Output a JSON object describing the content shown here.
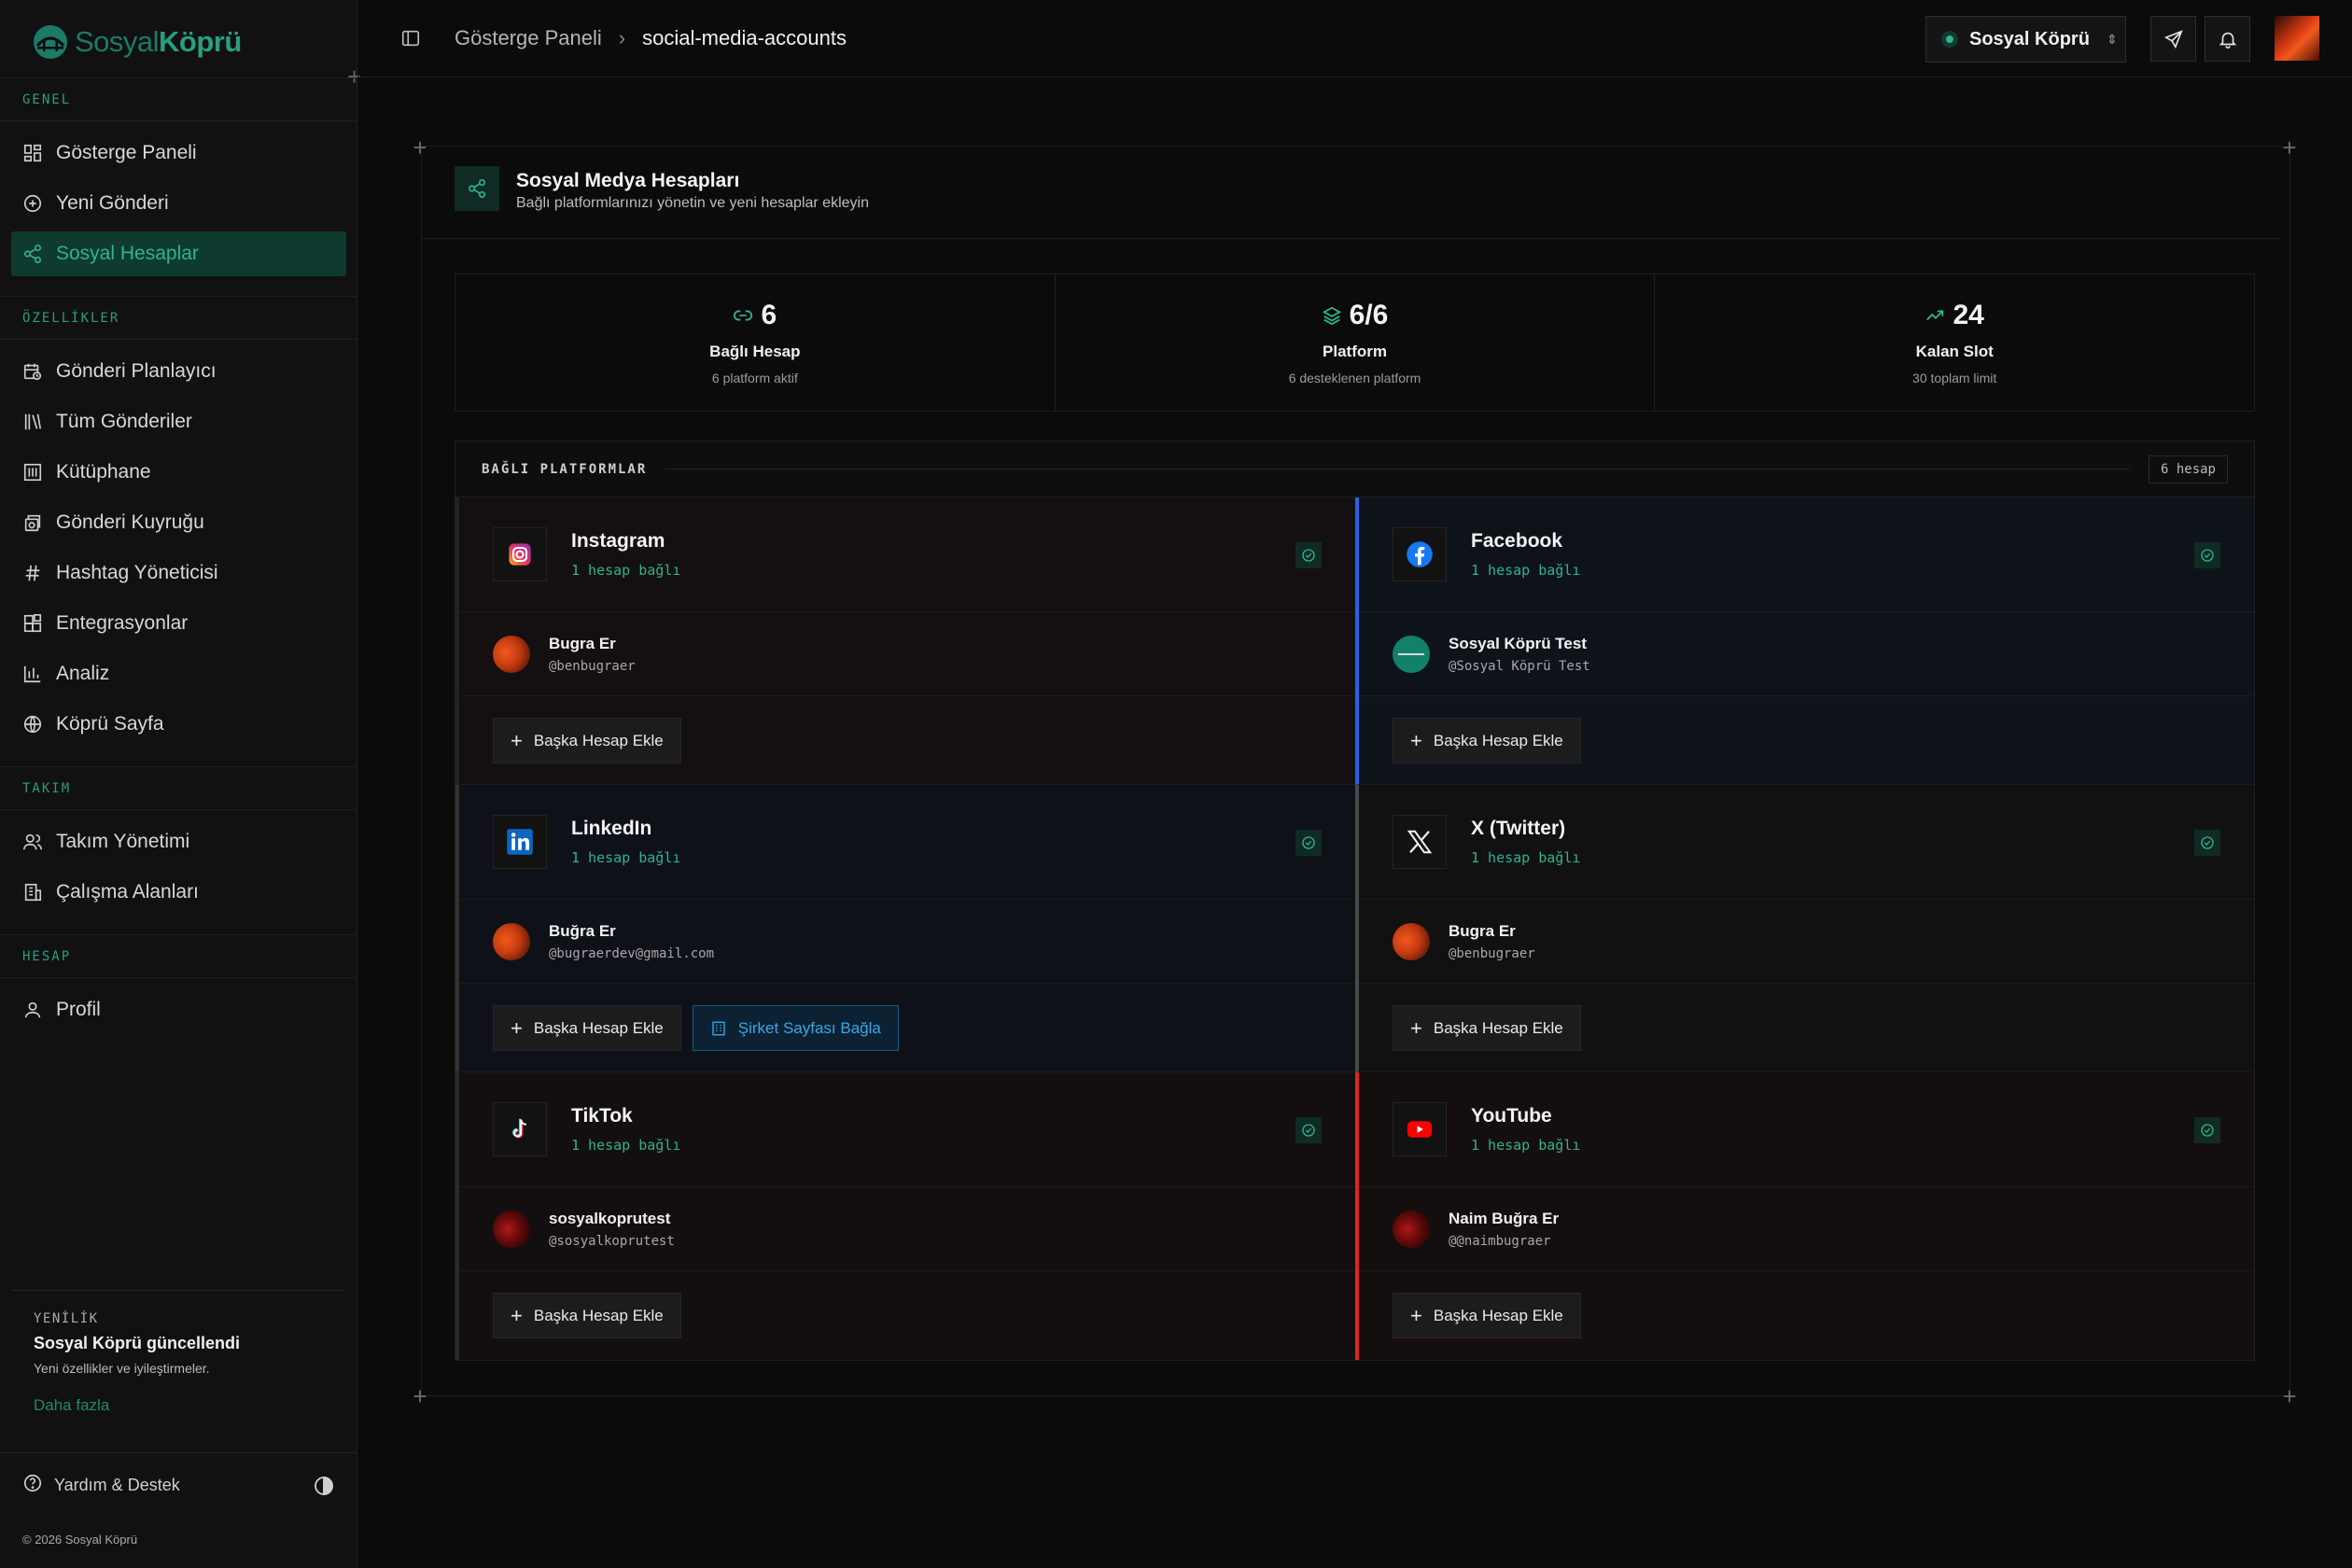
{
  "brand": {
    "name_light": "Sosyal",
    "name_bold": "Köprü"
  },
  "sidebar": {
    "sections": [
      {
        "heading": "GENEL",
        "items": [
          {
            "label": "Gösterge Paneli",
            "icon": "dashboard-icon"
          },
          {
            "label": "Yeni Gönderi",
            "icon": "plus-circle-icon"
          },
          {
            "label": "Sosyal Hesaplar",
            "icon": "share-icon",
            "active": true
          }
        ]
      },
      {
        "heading": "ÖZELLİKLER",
        "items": [
          {
            "label": "Gönderi Planlayıcı",
            "icon": "calendar-clock-icon"
          },
          {
            "label": "Tüm Gönderiler",
            "icon": "library-icon"
          },
          {
            "label": "Kütüphane",
            "icon": "archive-icon"
          },
          {
            "label": "Gönderi Kuyruğu",
            "icon": "queue-icon"
          },
          {
            "label": "Hashtag Yöneticisi",
            "icon": "hash-icon"
          },
          {
            "label": "Entegrasyonlar",
            "icon": "blocks-icon"
          },
          {
            "label": "Analiz",
            "icon": "bar-chart-icon"
          },
          {
            "label": "Köprü Sayfa",
            "icon": "globe-icon"
          }
        ]
      },
      {
        "heading": "TAKIM",
        "items": [
          {
            "label": "Takım Yönetimi",
            "icon": "users-icon"
          },
          {
            "label": "Çalışma Alanları",
            "icon": "building-icon"
          }
        ]
      },
      {
        "heading": "HESAP",
        "items": [
          {
            "label": "Profil",
            "icon": "user-icon"
          }
        ]
      }
    ],
    "news": {
      "tag": "YENİLİK",
      "title": "Sosyal Köprü güncellendi",
      "desc": "Yeni özellikler ve iyileştirmeler.",
      "more": "Daha fazla"
    },
    "help": "Yardım & Destek",
    "copyright": "© 2026 Sosyal Köprü"
  },
  "topbar": {
    "breadcrumb": [
      "Gösterge Paneli",
      "social-media-accounts"
    ],
    "workspace": "Sosyal Köprü"
  },
  "page": {
    "title": "Sosyal Medya Hesapları",
    "subtitle": "Bağlı platformlarınızı yönetin ve yeni hesaplar ekleyin"
  },
  "stats": [
    {
      "value": "6",
      "label": "Bağlı Hesap",
      "sub": "6 platform aktif",
      "icon": "link-icon"
    },
    {
      "value": "6/6",
      "label": "Platform",
      "sub": "6 desteklenen platform",
      "icon": "layers-icon"
    },
    {
      "value": "24",
      "label": "Kalan Slot",
      "sub": "30 toplam limit",
      "icon": "trending-up-icon"
    }
  ],
  "platforms": {
    "heading": "BAĞLI PLATFORMLAR",
    "count": "6 hesap",
    "add_label": "Başka Hesap Ekle",
    "company_label": "Şirket Sayfası Bağla",
    "items": [
      {
        "name": "Instagram",
        "connected": "1 hesap bağlı",
        "account_name": "Bugra Er",
        "account_handle": "@benbugraer",
        "accent": "#222222"
      },
      {
        "name": "Facebook",
        "connected": "1 hesap bağlı",
        "account_name": "Sosyal Köprü Test",
        "account_handle": "@Sosyal Köprü Test",
        "accent": "#2563eb"
      },
      {
        "name": "LinkedIn",
        "connected": "1 hesap bağlı",
        "account_name": "Buğra Er",
        "account_handle": "@bugraerdev@gmail.com",
        "accent": "#333333"
      },
      {
        "name": "X (Twitter)",
        "connected": "1 hesap bağlı",
        "account_name": "Bugra Er",
        "account_handle": "@benbugraer",
        "accent": "#4a4a4a"
      },
      {
        "name": "TikTok",
        "connected": "1 hesap bağlı",
        "account_name": "sosyalkoprutest",
        "account_handle": "@sosyalkoprutest",
        "accent": "#2a2a2a"
      },
      {
        "name": "YouTube",
        "connected": "1 hesap bağlı",
        "account_name": "Naim Buğra Er",
        "account_handle": "@@naimbugraer",
        "accent": "#dc2626"
      }
    ]
  },
  "colors": {
    "brand": "#2a9d82",
    "background": "#0b0b0b",
    "accent_green": "#2fb38f"
  }
}
